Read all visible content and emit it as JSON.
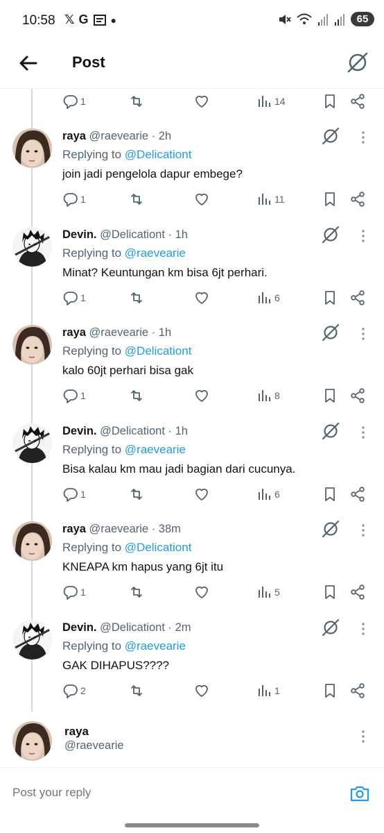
{
  "status_bar": {
    "time": "10:58",
    "left_icons": [
      "x-logo-icon",
      "google-icon",
      "news-icon",
      "dot-icon"
    ],
    "right_icons": [
      "mute-icon",
      "wifi-icon",
      "signal-icon",
      "signal-icon"
    ],
    "battery": "65"
  },
  "header": {
    "title": "Post",
    "back_icon": "arrow-left-icon",
    "grok_icon": "grok-icon"
  },
  "top_actions": {
    "replies": "1",
    "reposts": "",
    "likes": "",
    "views": "14"
  },
  "posts": [
    {
      "name": "raya",
      "handle": "@raevearie",
      "time": "· 2h",
      "replying_label": "Replying to ",
      "replying_to": "@Delicationt",
      "text": "join jadi pengelola dapur embege?",
      "replies": "1",
      "views": "11",
      "avatar": "raya"
    },
    {
      "name": "Devin.",
      "handle": "@Delicationt",
      "time": "· 1h",
      "replying_label": "Replying to ",
      "replying_to": "@raevearie",
      "text": "Minat? Keuntungan km bisa 6jt perhari.",
      "replies": "1",
      "views": "6",
      "avatar": "devin"
    },
    {
      "name": "raya",
      "handle": "@raevearie",
      "time": "· 1h",
      "replying_label": "Replying to ",
      "replying_to": "@Delicationt",
      "text": "kalo 60jt perhari bisa gak",
      "replies": "1",
      "views": "8",
      "avatar": "raya"
    },
    {
      "name": "Devin.",
      "handle": "@Delicationt",
      "time": "· 1h",
      "replying_label": "Replying to ",
      "replying_to": "@raevearie",
      "text": "Bisa kalau km mau jadi bagian dari cucunya.",
      "replies": "1",
      "views": "6",
      "avatar": "devin"
    },
    {
      "name": "raya",
      "handle": "@raevearie",
      "time": "· 38m",
      "replying_label": "Replying to ",
      "replying_to": "@Delicationt",
      "text": "KNEAPA km hapus yang 6jt itu",
      "replies": "1",
      "views": "5",
      "avatar": "raya"
    },
    {
      "name": "Devin.",
      "handle": "@Delicationt",
      "time": "· 2m",
      "replying_label": "Replying to ",
      "replying_to": "@raevearie",
      "text": "GAK DIHAPUS????",
      "replies": "2",
      "views": "1",
      "avatar": "devin"
    }
  ],
  "composer": {
    "name": "raya",
    "handle": "@raevearie",
    "placeholder": "Post your reply"
  },
  "colors": {
    "accent": "#1d9bf0",
    "secondary_text": "#536471",
    "primary_text": "#0f1419"
  }
}
